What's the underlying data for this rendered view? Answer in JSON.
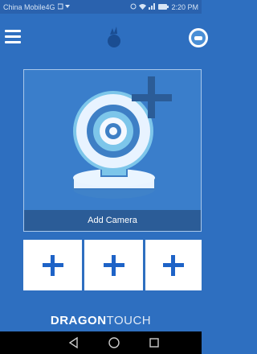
{
  "status_bar": {
    "carrier": "China Mobile4G",
    "time": "2:20 PM"
  },
  "app_bar": {
    "menu_icon": "hamburger-menu-icon",
    "logo_icon": "dragon-touch-logo-icon",
    "cloud_icon": "cloud-icon"
  },
  "main": {
    "add_camera_label": "Add Camera",
    "add_slots": [
      {
        "icon": "plus-icon"
      },
      {
        "icon": "plus-icon"
      },
      {
        "icon": "plus-icon"
      }
    ]
  },
  "brand": {
    "bold": "DRAGON",
    "light": "TOUCH"
  },
  "nav": {
    "back": "back-triangle-icon",
    "home": "home-circle-icon",
    "recent": "recent-square-icon"
  },
  "colors": {
    "background": "#2E6FC0",
    "accent": "#1E63C7"
  }
}
